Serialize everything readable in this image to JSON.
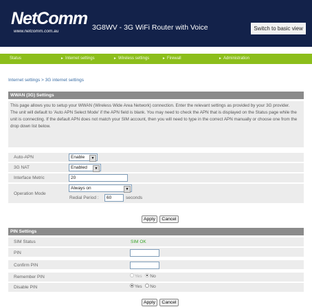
{
  "header": {
    "logo": "NetComm",
    "logo_url": "www.netcomm.com.au",
    "title": "3G8WV - 3G WiFi Router with Voice",
    "basic_view_button": "Switch to basic view"
  },
  "nav": {
    "items": [
      {
        "label": "Status",
        "bullet": ""
      },
      {
        "label": "Internet settings",
        "bullet": "►"
      },
      {
        "label": "Wireless settings",
        "bullet": "►"
      },
      {
        "label": "Firewall",
        "bullet": "►"
      },
      {
        "label": "Administration",
        "bullet": "►"
      }
    ]
  },
  "breadcrumb": "Internet settings > 3G internet settings",
  "wwan": {
    "heading": "WWAN (3G) Settings",
    "description_1": "This page allows you to setup your WWAN (Wireless Wide Area Network) connection. Enter the relevant settings as provided by your 3G provider.",
    "description_2": "The unit will default to 'Auto APN Select Mode' if the APN field is blank. You may need to check the APN that is displayed on the Status page while the unit is connecting. If the default APN does not match your SIM account, then you will need to type in the correct APN manually or choose one from the drop down list below.",
    "auto_apn_label": "Auto-APN",
    "auto_apn_value": "Enable",
    "nat_label": "3G NAT",
    "nat_value": "Enabled",
    "metric_label": "Interface Metric",
    "metric_value": "20",
    "op_mode_label": "Operation Mode",
    "op_mode_value": "Always on",
    "redial_label": "Redial Period :",
    "redial_value": "60",
    "redial_unit": "seconds",
    "apply": "Apply",
    "cancel": "Cancel"
  },
  "pin": {
    "heading": "PIN Settings",
    "sim_status_label": "SIM Status",
    "sim_status_value": "SIM OK",
    "sim_status_color": "#3aa52a",
    "pin_label": "PIN",
    "pin_value": "",
    "confirm_label": "Confirm PIN",
    "confirm_value": "",
    "remember_label": "Remember PIN",
    "disable_label": "Disable PIN",
    "yes": "Yes",
    "no": "No",
    "remember_selected": "No",
    "disable_selected": "Yes",
    "apply": "Apply",
    "cancel": "Cancel"
  }
}
